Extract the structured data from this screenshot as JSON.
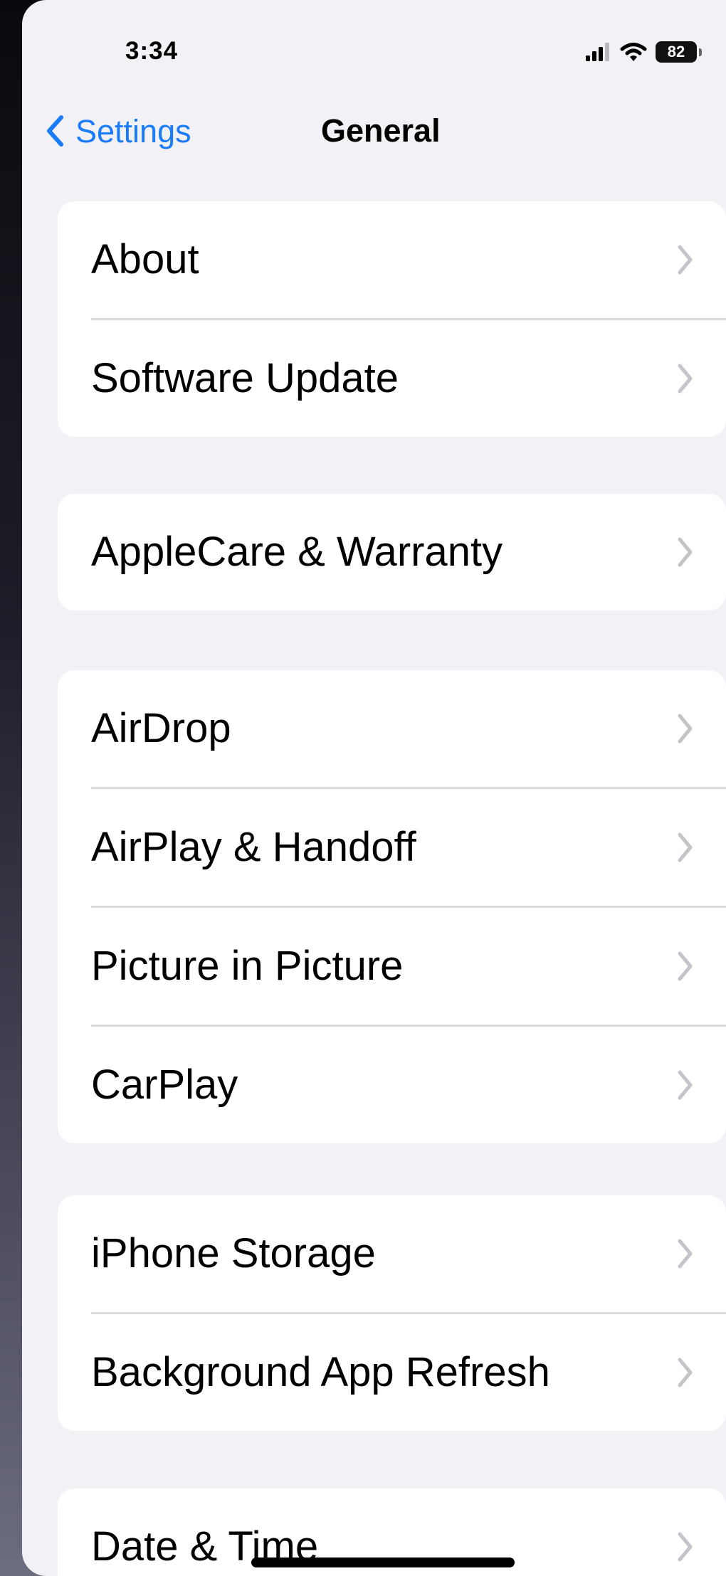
{
  "status_bar": {
    "time": "3:34",
    "battery": "82",
    "icons": [
      "cellular-signal-icon",
      "wifi-icon",
      "battery-icon"
    ]
  },
  "nav": {
    "back_label": "Settings",
    "title": "General"
  },
  "groups": [
    {
      "items": [
        {
          "label": "About"
        },
        {
          "label": "Software Update"
        }
      ]
    },
    {
      "items": [
        {
          "label": "AppleCare & Warranty"
        }
      ]
    },
    {
      "items": [
        {
          "label": "AirDrop"
        },
        {
          "label": "AirPlay & Handoff"
        },
        {
          "label": "Picture in Picture"
        },
        {
          "label": "CarPlay"
        }
      ]
    },
    {
      "items": [
        {
          "label": "iPhone Storage"
        },
        {
          "label": "Background App Refresh"
        }
      ]
    },
    {
      "items": [
        {
          "label": "Date & Time"
        }
      ]
    }
  ],
  "colors": {
    "accent": "#1a7cf8",
    "background": "#f2f1f6",
    "chevron": "#c4c4c9"
  }
}
